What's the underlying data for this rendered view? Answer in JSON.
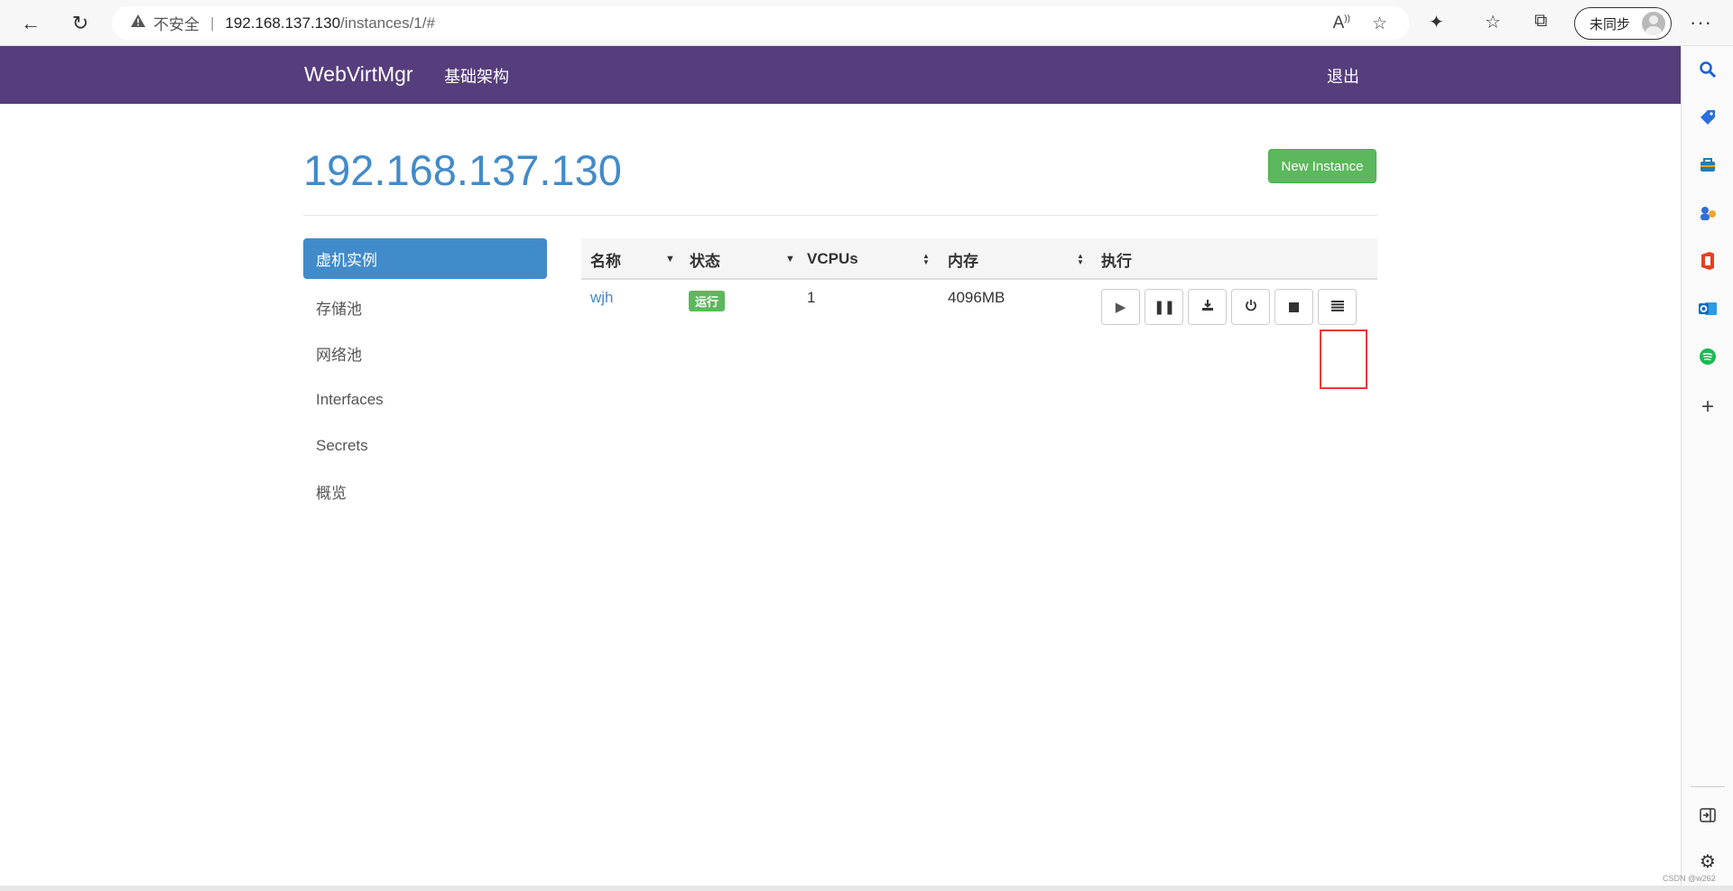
{
  "browser": {
    "security_label": "不安全",
    "url_host": "192.168.137.130",
    "url_path": "/instances/1/#",
    "sync_label": "未同步",
    "more_label": "···"
  },
  "app": {
    "brand": "WebVirtMgr",
    "nav_infra": "基础架构",
    "logout": "退出"
  },
  "main": {
    "host_title": "192.168.137.130",
    "new_instance_label": "New Instance"
  },
  "sidebar": {
    "items": [
      {
        "label": "虚机实例"
      },
      {
        "label": "存储池"
      },
      {
        "label": "网络池"
      },
      {
        "label": "Interfaces"
      },
      {
        "label": "Secrets"
      },
      {
        "label": "概览"
      }
    ]
  },
  "table": {
    "headers": [
      "名称",
      "状态",
      "VCPUs",
      "内存",
      "执行"
    ],
    "rows": [
      {
        "name": "wjh",
        "status": "运行",
        "vcpus": "1",
        "memory": "4096MB"
      }
    ]
  },
  "watermark": "CSDN @w262",
  "colors": {
    "navbar": "#563d7c",
    "accent": "#428bca",
    "success": "#5cb85c",
    "highlight": "#e53935"
  }
}
